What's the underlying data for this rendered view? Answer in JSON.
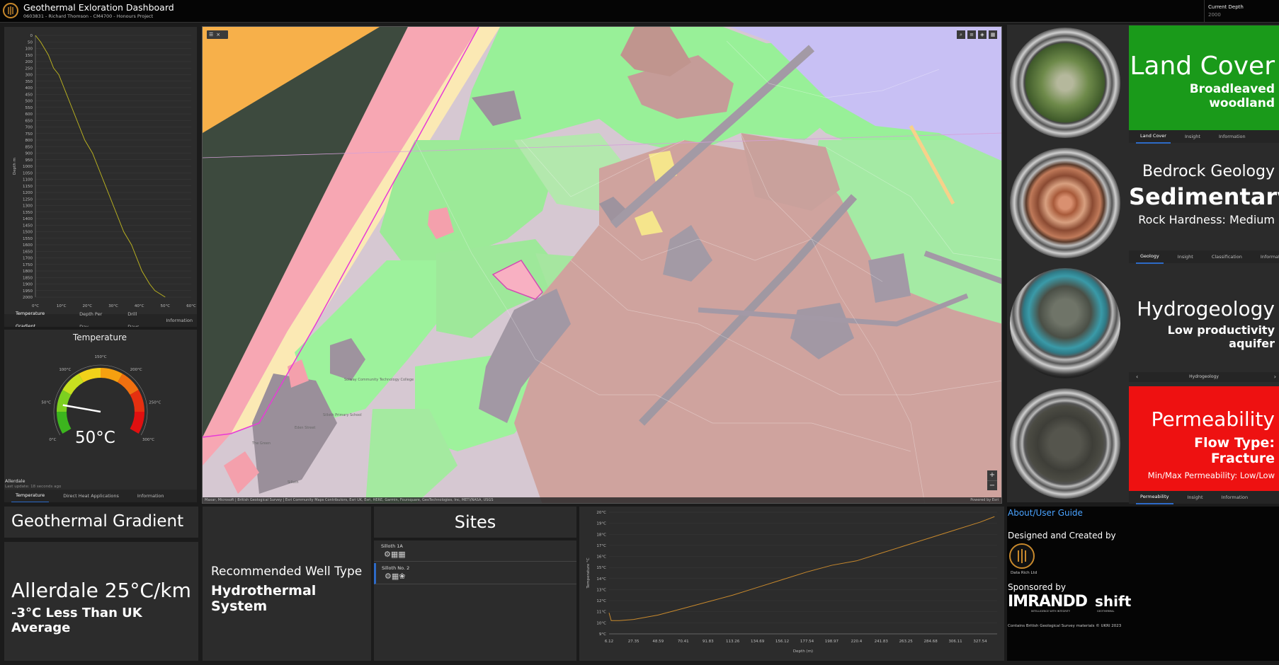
{
  "header": {
    "title": "Geothermal Exloration Dashboard",
    "subtitle": "0603831 - Richard Thomson - CM4700 - Honours Project",
    "current_depth_label": "Current Depth",
    "current_depth_value": "2000"
  },
  "depth_chart": {
    "ylabel": "Depth m",
    "tabs": [
      "Temperature Gradient",
      "Depth Per Day",
      "Drill Days",
      "Information"
    ],
    "active_tab": 0
  },
  "chart_data": [
    {
      "type": "line",
      "title": "",
      "xlabel": "",
      "ylabel": "Depth m",
      "x_tick_labels": [
        "0°C",
        "10°C",
        "20°C",
        "30°C",
        "40°C",
        "50°C",
        "60°C"
      ],
      "y_tick_labels": [
        "0",
        "50",
        "100",
        "150",
        "200",
        "250",
        "300",
        "350",
        "400",
        "450",
        "500",
        "550",
        "600",
        "650",
        "700",
        "750",
        "800",
        "850",
        "900",
        "950",
        "1000",
        "1050",
        "1100",
        "1150",
        "1200",
        "1250",
        "1300",
        "1350",
        "1400",
        "1450",
        "1500",
        "1550",
        "1600",
        "1650",
        "1700",
        "1750",
        "1800",
        "1850",
        "1900",
        "1950",
        "2000"
      ],
      "xlim": [
        0,
        60
      ],
      "ylim": [
        0,
        2000
      ],
      "y_inverted": true,
      "series": [
        {
          "color": "#b8b020",
          "points": [
            [
              0,
              0
            ],
            [
              2,
              50
            ],
            [
              5,
              150
            ],
            [
              7,
              250
            ],
            [
              9,
              300
            ],
            [
              11,
              400
            ],
            [
              13,
              500
            ],
            [
              15,
              600
            ],
            [
              17,
              700
            ],
            [
              19,
              800
            ],
            [
              22,
              900
            ],
            [
              24,
              1000
            ],
            [
              26,
              1100
            ],
            [
              28,
              1200
            ],
            [
              30,
              1300
            ],
            [
              32,
              1400
            ],
            [
              34,
              1500
            ],
            [
              37,
              1600
            ],
            [
              39,
              1700
            ],
            [
              41,
              1800
            ],
            [
              44,
              1900
            ],
            [
              46,
              1950
            ],
            [
              50,
              2000
            ]
          ]
        }
      ]
    },
    {
      "type": "gauge",
      "title": "Temperature",
      "value": 50,
      "value_label": "50°C",
      "min": 0,
      "max": 300,
      "tick_labels": [
        "0°C",
        "50°C",
        "100°C",
        "150°C",
        "200°C",
        "250°C",
        "300°C"
      ]
    },
    {
      "type": "line",
      "title": "",
      "xlabel": "Depth (m)",
      "ylabel": "Temperature °C",
      "x_tick_labels": [
        "6.12",
        "27.35",
        "48.59",
        "70.41",
        "91.83",
        "113.26",
        "134.69",
        "156.12",
        "177.54",
        "198.97",
        "220.4",
        "241.83",
        "263.25",
        "284.68",
        "306.11",
        "327.54"
      ],
      "y_tick_labels": [
        "9°C",
        "10°C",
        "11°C",
        "12°C",
        "13°C",
        "14°C",
        "15°C",
        "16°C",
        "17°C",
        "18°C",
        "19°C",
        "20°C"
      ],
      "xlim": [
        6.12,
        327.54
      ],
      "ylim": [
        9,
        20
      ],
      "series": [
        {
          "color": "#c8892c",
          "points": [
            [
              6.12,
              10.9
            ],
            [
              8,
              10.2
            ],
            [
              15,
              10.2
            ],
            [
              27.35,
              10.3
            ],
            [
              48.59,
              10.7
            ],
            [
              70.41,
              11.3
            ],
            [
              91.83,
              11.9
            ],
            [
              113.26,
              12.5
            ],
            [
              134.69,
              13.2
            ],
            [
              156.12,
              13.9
            ],
            [
              177.54,
              14.6
            ],
            [
              198.97,
              15.2
            ],
            [
              220.4,
              15.6
            ],
            [
              241.83,
              16.3
            ],
            [
              263.25,
              17.0
            ],
            [
              284.68,
              17.7
            ],
            [
              306.11,
              18.4
            ],
            [
              327.54,
              19.1
            ],
            [
              340,
              19.6
            ]
          ]
        }
      ]
    }
  ],
  "temperature_panel": {
    "title": "Temperature",
    "value_label": "50°C",
    "location": "Allerdale",
    "last_update": "Last update: 18 seconds ago",
    "tabs": [
      "Temperature",
      "Direct Heat Applications",
      "Information"
    ],
    "active_tab": 0
  },
  "map": {
    "attribution": "Maxar, Microsoft | British Geological Survey | Esri Community Maps Contributors, Esri UK, Esri, HERE, Garmin, Foursquare, GeoTechnologies, Inc, METI/NASA, USGS",
    "powered_by": "Powered by Esri",
    "zoom_in": "+",
    "zoom_out": "−",
    "labels": [
      "Solway Community Technology College",
      "Silloth Primary School",
      "The Green",
      "Eden Street",
      "Silloth"
    ]
  },
  "land_cover": {
    "title": "Land Cover",
    "value": "Broadleaved woodland",
    "color": "#1a9a1a",
    "tabs": [
      "Land Cover",
      "Insight",
      "Information"
    ],
    "active_tab": 0
  },
  "bedrock": {
    "title": "Bedrock Geology",
    "value": "Sedimentary",
    "hardness": "Rock Hardness: Medium",
    "tabs": [
      "Geology",
      "Insight",
      "Classification",
      "Information"
    ],
    "active_tab": 0
  },
  "hydrogeology": {
    "title": "Hydrogeology",
    "value": "Low productivity aquifer",
    "nav_label": "Hydrogeology",
    "prev": "‹",
    "next": "›"
  },
  "permeability": {
    "title": "Permeability",
    "flow_type": "Flow Type: Fracture",
    "minmax": "Min/Max Permeability: Low/Low",
    "color": "#ee1111",
    "tabs": [
      "Permeability",
      "Insight",
      "Information"
    ],
    "active_tab": 0
  },
  "gradient": {
    "title": "Geothermal Gradient",
    "value": "Allerdale 25°C/km",
    "comparison": "-3°C Less Than UK Average"
  },
  "well": {
    "line1": "Recommended Well Type",
    "line2": "Hydrothermal System"
  },
  "sites": {
    "title": "Sites",
    "items": [
      {
        "name": "Silloth 1A"
      },
      {
        "name": "Silloth No. 2"
      }
    ]
  },
  "about": {
    "link": "About/User Guide",
    "designed_by": "Designed and Created by",
    "company": "Data Rich Ltd",
    "sponsored_by": "Sponsored by",
    "sponsor1": "IMRANDD",
    "sponsor1_tagline": "INTELLIGENCE WITH INTEGRITY",
    "sponsor2": "shift",
    "sponsor2_tagline": "GEOTHERMAL",
    "bgs": "Contains British Geological Survey materials © UKRI 2023"
  },
  "colors": {
    "accent": "#2d6ac7",
    "panel": "#2c2c2c",
    "link": "#4aa3ff"
  }
}
